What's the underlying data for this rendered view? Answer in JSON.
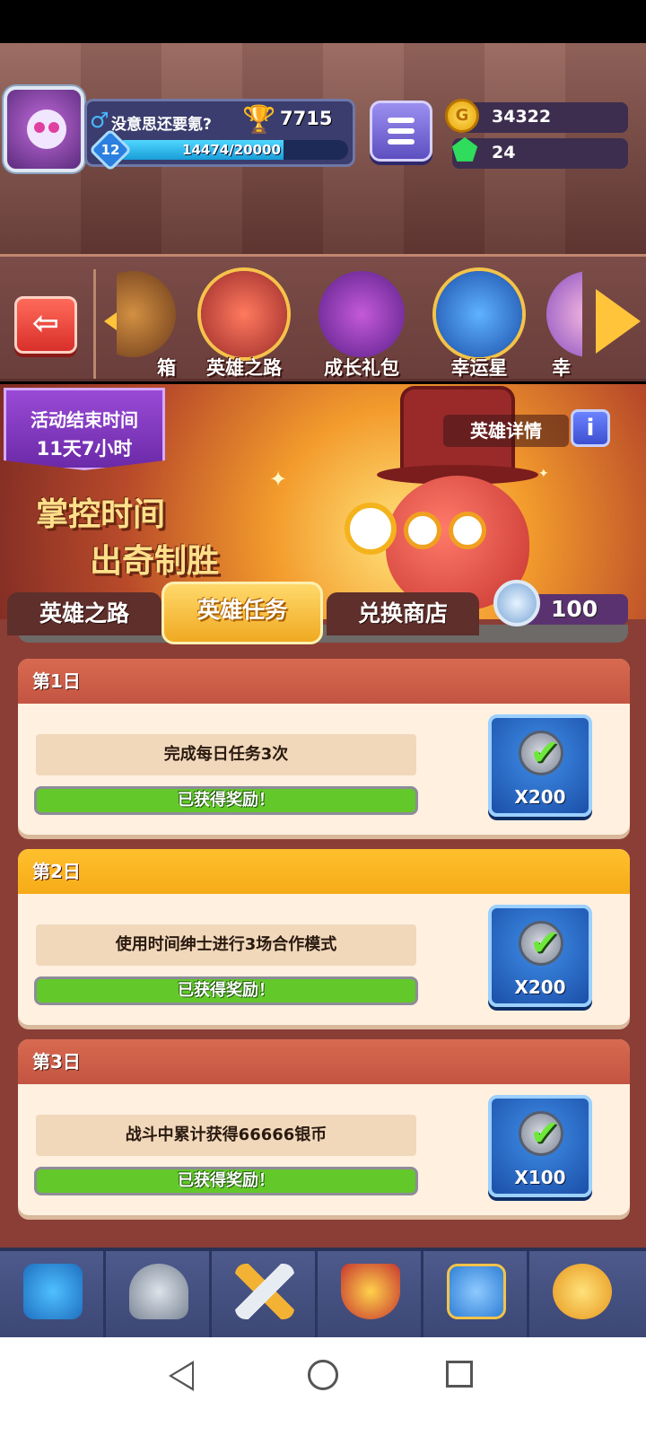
{
  "player": {
    "name": "没意思还要氪?",
    "gender_icon": "male-symbol-icon",
    "trophies": "7715",
    "level": "12",
    "xp_text": "14474/20000",
    "xp_fraction": 0.7237
  },
  "currency": {
    "coins": "34322",
    "gems": "24",
    "coin_icon": "gold-coin-icon",
    "gem_icon": "green-gem-icon"
  },
  "events": {
    "items": [
      {
        "label": "箱",
        "icon": "chest-icon"
      },
      {
        "label": "英雄之路",
        "icon": "time-gentleman-hero-icon"
      },
      {
        "label": "成长礼包",
        "icon": "gift-bag-icon"
      },
      {
        "label": "幸运星",
        "icon": "lucky-star-icon"
      },
      {
        "label": "幸",
        "icon": "lucky-icon"
      }
    ]
  },
  "banner": {
    "timer_label": "活动结束时间",
    "timer_value": "11天7小时",
    "slogan_line1": "掌控时间",
    "slogan_line2": "出奇制胜",
    "hero_details_label": "英雄详情",
    "info_icon": "info-icon"
  },
  "tabs": [
    {
      "label": "英雄之路",
      "active": false
    },
    {
      "label": "英雄任务",
      "active": true
    },
    {
      "label": "兑换商店",
      "active": false
    }
  ],
  "token": {
    "value": "100",
    "icon": "hero-token-icon"
  },
  "tasks": [
    {
      "day": "第1日",
      "description": "完成每日任务3次",
      "status": "已获得奖励！",
      "reward": "X200",
      "progress": 1.0
    },
    {
      "day": "第2日",
      "description": "使用时间绅士进行3场合作模式",
      "status": "已获得奖励！",
      "reward": "X200",
      "progress": 1.0
    },
    {
      "day": "第3日",
      "description": "战斗中累计获得66666银币",
      "status": "已获得奖励！",
      "reward": "X100",
      "progress": 1.0
    }
  ],
  "bottom_nav": [
    {
      "icon": "treasure-chest-icon"
    },
    {
      "icon": "knight-helmet-icon"
    },
    {
      "icon": "crossed-swords-icon"
    },
    {
      "icon": "crown-shield-icon"
    },
    {
      "icon": "team-banner-icon"
    },
    {
      "icon": "compass-icon"
    }
  ],
  "colors": {
    "accent_gold": "#f6ab17",
    "progress_green": "#63c82a",
    "header_red": "#c35442",
    "reward_blue": "#1b4fa8"
  }
}
